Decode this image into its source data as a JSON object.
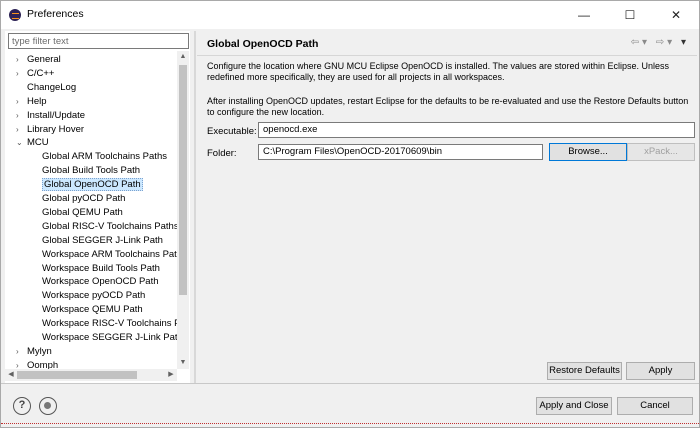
{
  "window": {
    "title": "Preferences",
    "minimize": "—",
    "maximize": "☐",
    "close": "✕"
  },
  "filter": {
    "placeholder": "type filter text",
    "value": ""
  },
  "tree": [
    {
      "label": "General",
      "level": 0,
      "arrow": "›",
      "selected": false
    },
    {
      "label": "C/C++",
      "level": 0,
      "arrow": "›",
      "selected": false
    },
    {
      "label": "ChangeLog",
      "level": 0,
      "arrow": "",
      "selected": false
    },
    {
      "label": "Help",
      "level": 0,
      "arrow": "›",
      "selected": false
    },
    {
      "label": "Install/Update",
      "level": 0,
      "arrow": "›",
      "selected": false
    },
    {
      "label": "Library Hover",
      "level": 0,
      "arrow": "›",
      "selected": false
    },
    {
      "label": "MCU",
      "level": 0,
      "arrow": "⌄",
      "selected": false
    },
    {
      "label": "Global ARM Toolchains Paths",
      "level": 1,
      "arrow": "",
      "selected": false
    },
    {
      "label": "Global Build Tools Path",
      "level": 1,
      "arrow": "",
      "selected": false
    },
    {
      "label": "Global OpenOCD Path",
      "level": 1,
      "arrow": "",
      "selected": true
    },
    {
      "label": "Global pyOCD Path",
      "level": 1,
      "arrow": "",
      "selected": false
    },
    {
      "label": "Global QEMU Path",
      "level": 1,
      "arrow": "",
      "selected": false
    },
    {
      "label": "Global RISC-V Toolchains Paths",
      "level": 1,
      "arrow": "",
      "selected": false
    },
    {
      "label": "Global SEGGER J-Link Path",
      "level": 1,
      "arrow": "",
      "selected": false
    },
    {
      "label": "Workspace ARM Toolchains Path",
      "level": 1,
      "arrow": "",
      "selected": false
    },
    {
      "label": "Workspace Build Tools Path",
      "level": 1,
      "arrow": "",
      "selected": false
    },
    {
      "label": "Workspace OpenOCD Path",
      "level": 1,
      "arrow": "",
      "selected": false
    },
    {
      "label": "Workspace pyOCD Path",
      "level": 1,
      "arrow": "",
      "selected": false
    },
    {
      "label": "Workspace QEMU Path",
      "level": 1,
      "arrow": "",
      "selected": false
    },
    {
      "label": "Workspace RISC-V Toolchains Pat",
      "level": 1,
      "arrow": "",
      "selected": false
    },
    {
      "label": "Workspace SEGGER J-Link Path",
      "level": 1,
      "arrow": "",
      "selected": false
    },
    {
      "label": "Mylyn",
      "level": 0,
      "arrow": "›",
      "selected": false
    },
    {
      "label": "Oomph",
      "level": 0,
      "arrow": "›",
      "selected": false
    }
  ],
  "page": {
    "title": "Global OpenOCD Path",
    "back_icon": "⇦",
    "back_menu_icon": "▾",
    "forward_icon": "⇨",
    "forward_menu_icon": "▾",
    "view_menu_icon": "▾",
    "description1": "Configure the location where GNU MCU Eclipse OpenOCD is installed. The values are stored within Eclipse. Unless redefined more specifically, they are used for all projects in all workspaces.",
    "description2": "After installing OpenOCD updates, restart Eclipse for the defaults to be re-evaluated and use the Restore Defaults button to configure the new location.",
    "executable_label": "Executable:",
    "executable_value": "openocd.exe",
    "folder_label": "Folder:",
    "folder_value": "C:\\Program Files\\OpenOCD-20170609\\bin",
    "browse_label": "Browse...",
    "xpack_label": "xPack...",
    "restore_defaults_label": "Restore Defaults",
    "apply_label": "Apply"
  },
  "footer": {
    "help_icon": "?",
    "apply_close_label": "Apply and Close",
    "cancel_label": "Cancel"
  }
}
